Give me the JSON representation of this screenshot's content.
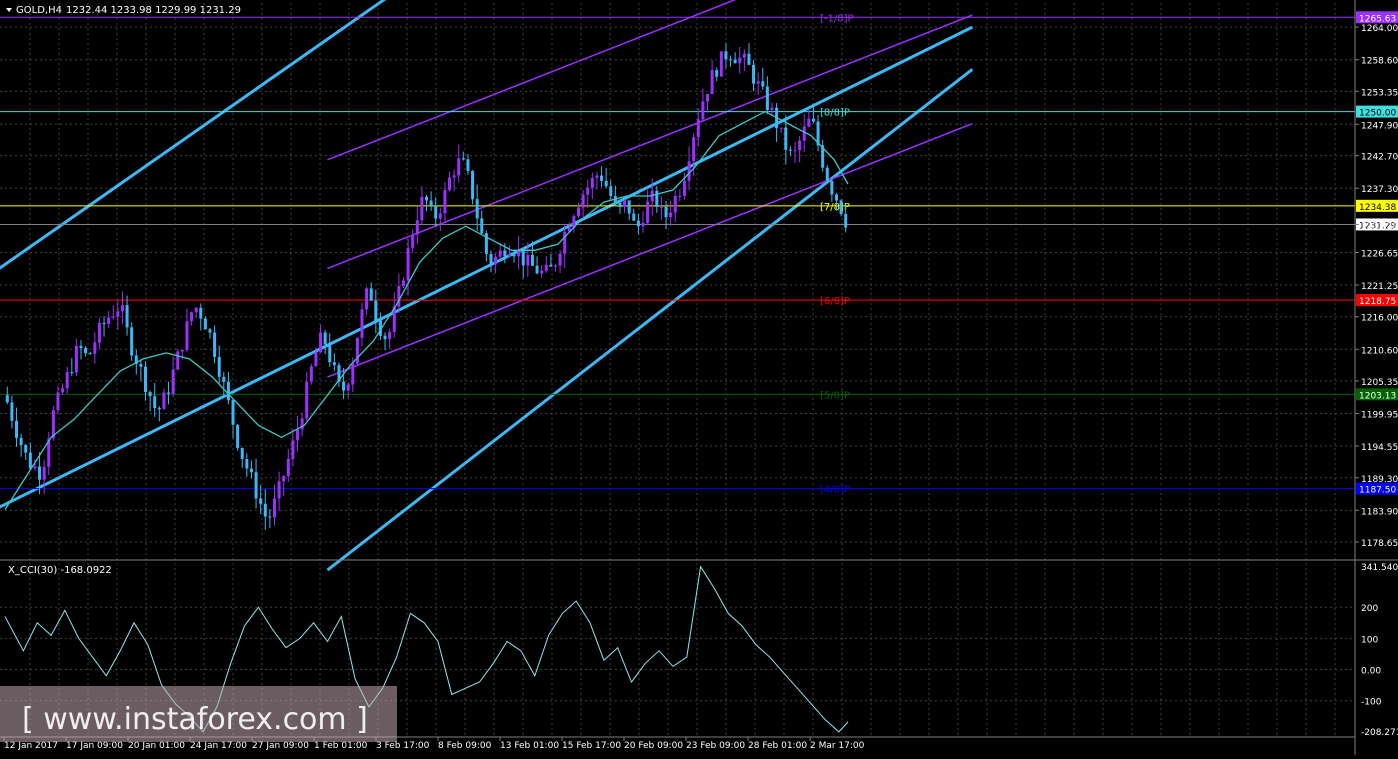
{
  "header": {
    "symbol_label": "GOLD,H4",
    "ohlc": "1232.44 1233.98 1229.99 1231.29"
  },
  "indicator": {
    "label": "X_CCI(30) -168.0922",
    "axis_labels": [
      "341.5407",
      "200",
      "100",
      "0.00",
      "-100",
      "-208.2719"
    ]
  },
  "colors": {
    "background": "#000000",
    "grid": "#404040",
    "bull_candle": "#9B30FF",
    "bear_candle": "#3DB8F5",
    "ma": "#40C8C8",
    "cci": "#8CE8F0",
    "channel_blue": "#3DB8F5",
    "channel_purple": "#9B30FF",
    "level_purple": "#9B30FF",
    "level_cyan": "#40E0E0",
    "level_yellow": "#FFFF00",
    "level_red": "#FF0000",
    "level_green": "#006400",
    "level_blue": "#0000FF"
  },
  "chart_data": {
    "type": "candlestick",
    "price_axis_ticks": [
      "1264.00",
      "1258.60",
      "1253.35",
      "1247.90",
      "1242.70",
      "1237.30",
      "1231.29",
      "1226.65",
      "1221.25",
      "1216.00",
      "1210.60",
      "1205.35",
      "1199.95",
      "1194.55",
      "1189.30",
      "1183.90",
      "1178.65"
    ],
    "time_axis_ticks": [
      "12 Jan 2017",
      "17 Jan 09:00",
      "20 Jan 01:00",
      "24 Jan 17:00",
      "27 Jan 09:00",
      "1 Feb 01:00",
      "3 Feb 17:00",
      "8 Feb 09:00",
      "13 Feb 01:00",
      "15 Feb 17:00",
      "20 Feb 09:00",
      "23 Feb 09:00",
      "28 Feb 01:00",
      "2 Mar 17:00"
    ],
    "ylim": [
      1176,
      1268
    ],
    "levels": [
      {
        "label": "[-1/8]P",
        "price": 1265.63,
        "color": "#9B30FF",
        "price_label": "1265.63"
      },
      {
        "label": "[8/8]P",
        "price": 1250.0,
        "color": "#40E0E0",
        "price_label": "1250.00"
      },
      {
        "label": "[7/8]P",
        "price": 1234.38,
        "color": "#FFFF00",
        "price_label": "1234.38"
      },
      {
        "label": "[6/8]P",
        "price": 1218.75,
        "color": "#FF0000",
        "price_label": "1218.75"
      },
      {
        "label": "[5/8]P",
        "price": 1203.13,
        "color": "#006400",
        "price_label": "1203.13"
      },
      {
        "label": "[4/8]P",
        "price": 1187.5,
        "color": "#0000FF",
        "price_label": "1187.50"
      }
    ],
    "current_price": {
      "price": 1231.29,
      "label": "1231.29"
    },
    "close_path": [
      [
        0,
        1203
      ],
      [
        6,
        1196
      ],
      [
        10,
        1192
      ],
      [
        16,
        1190
      ],
      [
        20,
        1199
      ],
      [
        24,
        1203
      ],
      [
        28,
        1207
      ],
      [
        32,
        1211
      ],
      [
        36,
        1209
      ],
      [
        40,
        1213
      ],
      [
        45,
        1216
      ],
      [
        50,
        1218
      ],
      [
        54,
        1212
      ],
      [
        58,
        1208
      ],
      [
        62,
        1204
      ],
      [
        66,
        1200
      ],
      [
        70,
        1203
      ],
      [
        74,
        1208
      ],
      [
        78,
        1213
      ],
      [
        82,
        1218
      ],
      [
        86,
        1216
      ],
      [
        90,
        1212
      ],
      [
        94,
        1206
      ],
      [
        98,
        1200
      ],
      [
        102,
        1194
      ],
      [
        106,
        1190
      ],
      [
        110,
        1186
      ],
      [
        114,
        1182
      ],
      [
        118,
        1186
      ],
      [
        122,
        1191
      ],
      [
        126,
        1196
      ],
      [
        130,
        1202
      ],
      [
        134,
        1209
      ],
      [
        138,
        1213
      ],
      [
        142,
        1208
      ],
      [
        146,
        1203
      ],
      [
        150,
        1207
      ],
      [
        154,
        1215
      ],
      [
        158,
        1221
      ],
      [
        162,
        1215
      ],
      [
        166,
        1212
      ],
      [
        170,
        1218
      ],
      [
        174,
        1225
      ],
      [
        178,
        1232
      ],
      [
        182,
        1236
      ],
      [
        186,
        1232
      ],
      [
        190,
        1235
      ],
      [
        194,
        1240
      ],
      [
        198,
        1242
      ],
      [
        202,
        1238
      ],
      [
        206,
        1231
      ],
      [
        210,
        1225
      ],
      [
        214,
        1226
      ],
      [
        218,
        1228
      ],
      [
        222,
        1227
      ],
      [
        226,
        1225
      ],
      [
        230,
        1224
      ],
      [
        234,
        1223
      ],
      [
        238,
        1224
      ],
      [
        242,
        1229
      ],
      [
        246,
        1233
      ],
      [
        250,
        1236
      ],
      [
        254,
        1238
      ],
      [
        258,
        1240
      ],
      [
        262,
        1237
      ],
      [
        266,
        1233
      ],
      [
        270,
        1235
      ],
      [
        274,
        1230
      ],
      [
        278,
        1234
      ],
      [
        282,
        1236
      ],
      [
        286,
        1232
      ],
      [
        290,
        1235
      ],
      [
        294,
        1238
      ],
      [
        298,
        1245
      ],
      [
        302,
        1251
      ],
      [
        306,
        1255
      ],
      [
        310,
        1258
      ],
      [
        314,
        1260
      ],
      [
        318,
        1259
      ],
      [
        322,
        1258
      ],
      [
        326,
        1255
      ],
      [
        330,
        1252
      ],
      [
        334,
        1249
      ],
      [
        338,
        1245
      ],
      [
        342,
        1242
      ],
      [
        346,
        1246
      ],
      [
        350,
        1249
      ],
      [
        354,
        1243
      ],
      [
        358,
        1238
      ],
      [
        362,
        1235
      ],
      [
        366,
        1231
      ]
    ],
    "ma_path": [
      [
        0,
        1184
      ],
      [
        10,
        1190
      ],
      [
        20,
        1196
      ],
      [
        30,
        1199
      ],
      [
        40,
        1203
      ],
      [
        50,
        1207
      ],
      [
        60,
        1209
      ],
      [
        70,
        1210
      ],
      [
        80,
        1209
      ],
      [
        90,
        1206
      ],
      [
        100,
        1202
      ],
      [
        110,
        1198
      ],
      [
        120,
        1196
      ],
      [
        130,
        1198
      ],
      [
        140,
        1203
      ],
      [
        150,
        1208
      ],
      [
        160,
        1212
      ],
      [
        170,
        1218
      ],
      [
        180,
        1225
      ],
      [
        190,
        1229
      ],
      [
        200,
        1231
      ],
      [
        210,
        1229
      ],
      [
        220,
        1227
      ],
      [
        230,
        1227
      ],
      [
        240,
        1228
      ],
      [
        250,
        1232
      ],
      [
        260,
        1235
      ],
      [
        270,
        1236
      ],
      [
        280,
        1236
      ],
      [
        290,
        1237
      ],
      [
        300,
        1241
      ],
      [
        310,
        1246
      ],
      [
        320,
        1248
      ],
      [
        330,
        1250
      ],
      [
        340,
        1248
      ],
      [
        350,
        1246
      ],
      [
        360,
        1242
      ],
      [
        366,
        1238
      ]
    ],
    "cci_path": [
      [
        0,
        170
      ],
      [
        8,
        60
      ],
      [
        14,
        150
      ],
      [
        20,
        110
      ],
      [
        26,
        190
      ],
      [
        32,
        100
      ],
      [
        38,
        40
      ],
      [
        44,
        -20
      ],
      [
        50,
        60
      ],
      [
        56,
        150
      ],
      [
        62,
        80
      ],
      [
        68,
        -50
      ],
      [
        74,
        -110
      ],
      [
        80,
        -150
      ],
      [
        86,
        -200
      ],
      [
        92,
        -120
      ],
      [
        98,
        20
      ],
      [
        104,
        140
      ],
      [
        110,
        200
      ],
      [
        116,
        130
      ],
      [
        122,
        70
      ],
      [
        128,
        100
      ],
      [
        134,
        150
      ],
      [
        140,
        90
      ],
      [
        146,
        170
      ],
      [
        152,
        -30
      ],
      [
        158,
        -120
      ],
      [
        164,
        -60
      ],
      [
        170,
        40
      ],
      [
        176,
        180
      ],
      [
        182,
        150
      ],
      [
        188,
        90
      ],
      [
        194,
        -80
      ],
      [
        200,
        -60
      ],
      [
        206,
        -40
      ],
      [
        212,
        20
      ],
      [
        218,
        90
      ],
      [
        224,
        60
      ],
      [
        230,
        -20
      ],
      [
        236,
        110
      ],
      [
        242,
        180
      ],
      [
        248,
        220
      ],
      [
        254,
        150
      ],
      [
        260,
        30
      ],
      [
        266,
        70
      ],
      [
        272,
        -40
      ],
      [
        278,
        20
      ],
      [
        284,
        60
      ],
      [
        290,
        10
      ],
      [
        296,
        40
      ],
      [
        302,
        330
      ],
      [
        308,
        260
      ],
      [
        314,
        180
      ],
      [
        320,
        140
      ],
      [
        326,
        80
      ],
      [
        332,
        40
      ],
      [
        338,
        -10
      ],
      [
        344,
        -60
      ],
      [
        350,
        -110
      ],
      [
        356,
        -160
      ],
      [
        362,
        -200
      ],
      [
        366,
        -168
      ]
    ],
    "channel_lines": [
      {
        "color": "#3DB8F5",
        "from": [
          -10,
          1222
        ],
        "to": [
          200,
          1278
        ]
      },
      {
        "color": "#3DB8F5",
        "from": [
          -10,
          1183
        ],
        "to": [
          420,
          1264
        ]
      },
      {
        "color": "#3DB8F5",
        "from": [
          140,
          1174
        ],
        "to": [
          420,
          1257
        ]
      },
      {
        "color": "#9B30FF",
        "from": [
          140,
          1242
        ],
        "to": [
          420,
          1284
        ]
      },
      {
        "color": "#9B30FF",
        "from": [
          140,
          1224
        ],
        "to": [
          420,
          1266
        ]
      },
      {
        "color": "#9B30FF",
        "from": [
          140,
          1206
        ],
        "to": [
          420,
          1248
        ]
      }
    ]
  }
}
